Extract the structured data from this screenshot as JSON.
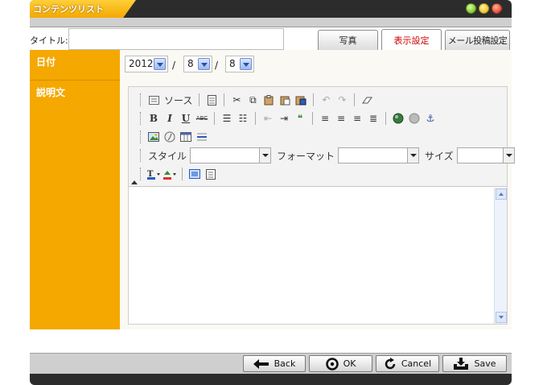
{
  "window": {
    "title": "コンテンツリスト"
  },
  "form": {
    "title_label": "タイトル:",
    "title_value": "",
    "date_label": "日付",
    "desc_label": "説明文"
  },
  "tabs": [
    {
      "label": "写真",
      "active": false
    },
    {
      "label": "表示設定",
      "active": true
    },
    {
      "label": "メール投稿設定",
      "active": false
    }
  ],
  "date": {
    "year": "2012",
    "month": "8",
    "day": "8",
    "separator": "/"
  },
  "editor": {
    "source_label": "ソース",
    "style_label": "スタイル",
    "format_label": "フォーマット",
    "size_label": "サイズ",
    "bold_glyph": "B",
    "italic_glyph": "I",
    "underline_glyph": "U",
    "strike_glyph": "ABC",
    "style_value": "",
    "format_value": "",
    "size_value": ""
  },
  "footer": {
    "back": "Back",
    "ok": "OK",
    "cancel": "Cancel",
    "save": "Save"
  },
  "colors": {
    "accent": "#f4a800",
    "active_tab_text": "#d00000",
    "titlebar": "#2c2c2c"
  }
}
